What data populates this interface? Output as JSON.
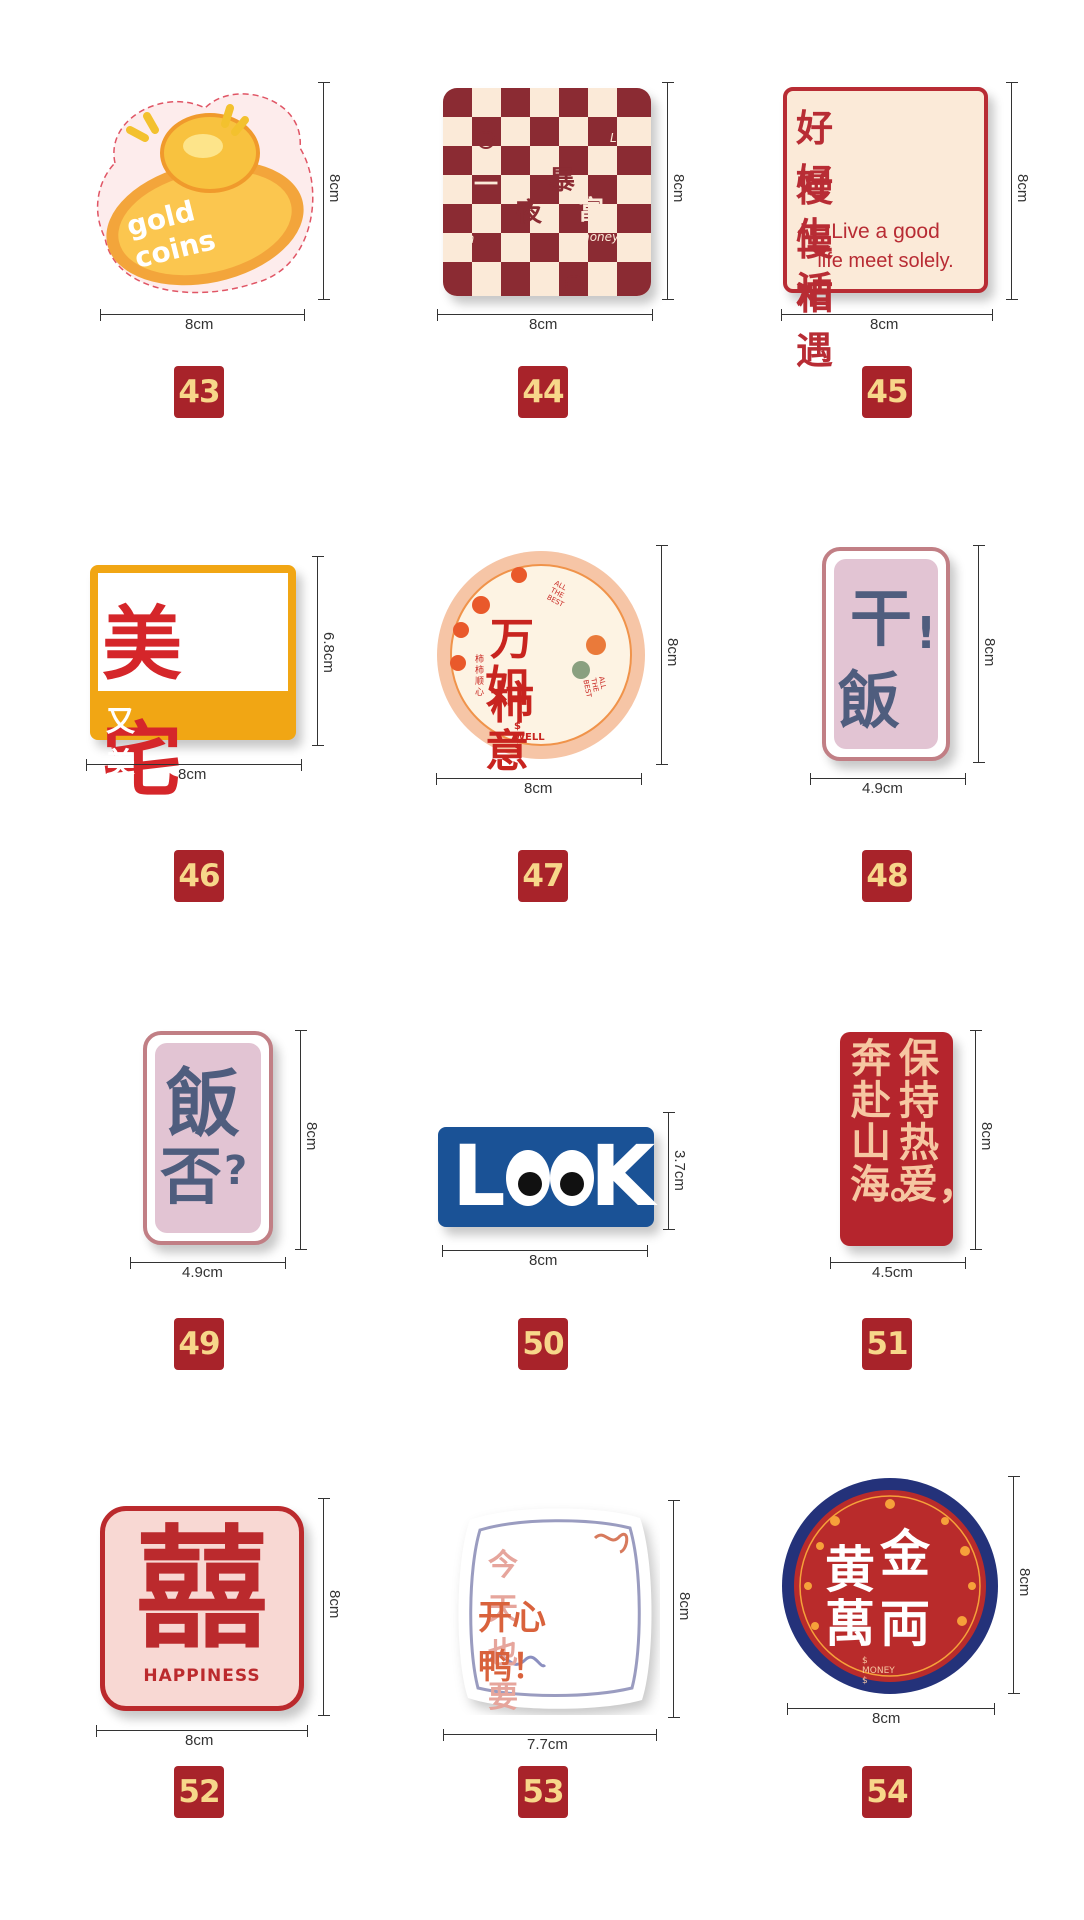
{
  "items": [
    {
      "number": "43",
      "width": "8cm",
      "height": "8cm",
      "text": "gold coins"
    },
    {
      "number": "44",
      "width": "8cm",
      "height": "8cm",
      "words": [
        "Lucky",
        "rich",
        "money"
      ],
      "chars": [
        "一",
        "暴",
        "夜",
        "富"
      ]
    },
    {
      "number": "45",
      "width": "8cm",
      "height": "8cm",
      "line1": "好好生活",
      "line2": "慢慢相遇",
      "en1": "Live a good",
      "en2": "life meet solely."
    },
    {
      "number": "46",
      "width": "8cm",
      "height": "6.8cm",
      "main": "美宅",
      "sub": "又美又宅"
    },
    {
      "number": "47",
      "width": "8cm",
      "height": "8cm",
      "line1": "万柿",
      "line2": "如意",
      "top": "ALL THE BEST",
      "side": "ALL THE BEST",
      "vertical": "柿柿顺心",
      "bottom": "$ WELL $"
    },
    {
      "number": "48",
      "width": "4.9cm",
      "height": "8cm",
      "line1": "干",
      "line2": "飯",
      "mark": "!"
    },
    {
      "number": "49",
      "width": "4.9cm",
      "height": "8cm",
      "line1": "飯",
      "line2": "否",
      "mark": "?"
    },
    {
      "number": "50",
      "width": "8cm",
      "height": "3.7cm",
      "text_l": "L",
      "text_k": "K"
    },
    {
      "number": "51",
      "width": "4.5cm",
      "height": "8cm",
      "col1": "保持热爱，",
      "col2": "奔赴山海。"
    },
    {
      "number": "52",
      "width": "8cm",
      "height": "8cm",
      "main": "囍",
      "sub": "HAPPINESS"
    },
    {
      "number": "53",
      "width": "7.7cm",
      "height": "8cm",
      "line1": "今天也要",
      "line2": "开心鸭！"
    },
    {
      "number": "54",
      "width": "8cm",
      "height": "8cm",
      "c1": "黄",
      "c2": "金",
      "c3": "萬",
      "c4": "両",
      "bottom": "$ MONEY $"
    }
  ],
  "colors": {
    "badge": "#a8232a",
    "badge_text": "#f7d78a",
    "red": "#b5252d",
    "cream": "#fbe9d2"
  }
}
